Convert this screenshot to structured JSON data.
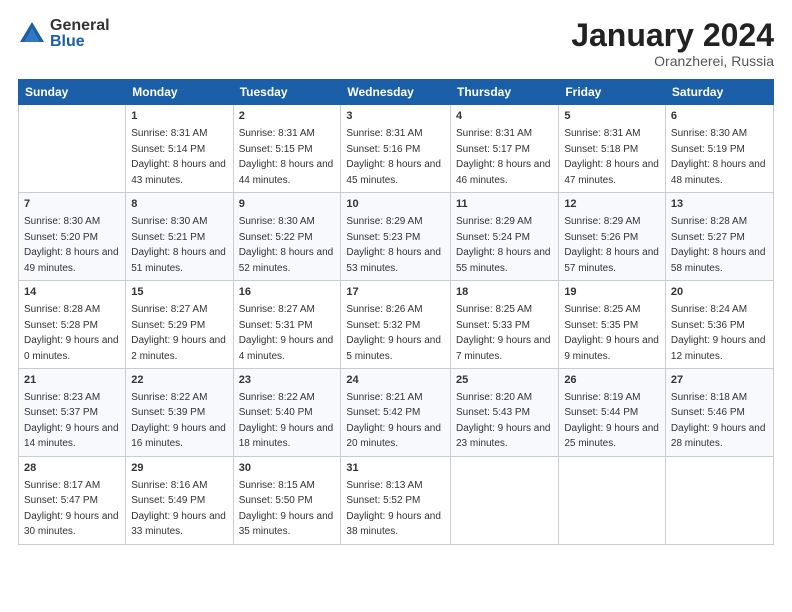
{
  "logo": {
    "general": "General",
    "blue": "Blue"
  },
  "header": {
    "month": "January 2024",
    "location": "Oranzherei, Russia"
  },
  "weekdays": [
    "Sunday",
    "Monday",
    "Tuesday",
    "Wednesday",
    "Thursday",
    "Friday",
    "Saturday"
  ],
  "weeks": [
    [
      {
        "day": "",
        "sunrise": "",
        "sunset": "",
        "daylight": ""
      },
      {
        "day": "1",
        "sunrise": "Sunrise: 8:31 AM",
        "sunset": "Sunset: 5:14 PM",
        "daylight": "Daylight: 8 hours and 43 minutes."
      },
      {
        "day": "2",
        "sunrise": "Sunrise: 8:31 AM",
        "sunset": "Sunset: 5:15 PM",
        "daylight": "Daylight: 8 hours and 44 minutes."
      },
      {
        "day": "3",
        "sunrise": "Sunrise: 8:31 AM",
        "sunset": "Sunset: 5:16 PM",
        "daylight": "Daylight: 8 hours and 45 minutes."
      },
      {
        "day": "4",
        "sunrise": "Sunrise: 8:31 AM",
        "sunset": "Sunset: 5:17 PM",
        "daylight": "Daylight: 8 hours and 46 minutes."
      },
      {
        "day": "5",
        "sunrise": "Sunrise: 8:31 AM",
        "sunset": "Sunset: 5:18 PM",
        "daylight": "Daylight: 8 hours and 47 minutes."
      },
      {
        "day": "6",
        "sunrise": "Sunrise: 8:30 AM",
        "sunset": "Sunset: 5:19 PM",
        "daylight": "Daylight: 8 hours and 48 minutes."
      }
    ],
    [
      {
        "day": "7",
        "sunrise": "Sunrise: 8:30 AM",
        "sunset": "Sunset: 5:20 PM",
        "daylight": "Daylight: 8 hours and 49 minutes."
      },
      {
        "day": "8",
        "sunrise": "Sunrise: 8:30 AM",
        "sunset": "Sunset: 5:21 PM",
        "daylight": "Daylight: 8 hours and 51 minutes."
      },
      {
        "day": "9",
        "sunrise": "Sunrise: 8:30 AM",
        "sunset": "Sunset: 5:22 PM",
        "daylight": "Daylight: 8 hours and 52 minutes."
      },
      {
        "day": "10",
        "sunrise": "Sunrise: 8:29 AM",
        "sunset": "Sunset: 5:23 PM",
        "daylight": "Daylight: 8 hours and 53 minutes."
      },
      {
        "day": "11",
        "sunrise": "Sunrise: 8:29 AM",
        "sunset": "Sunset: 5:24 PM",
        "daylight": "Daylight: 8 hours and 55 minutes."
      },
      {
        "day": "12",
        "sunrise": "Sunrise: 8:29 AM",
        "sunset": "Sunset: 5:26 PM",
        "daylight": "Daylight: 8 hours and 57 minutes."
      },
      {
        "day": "13",
        "sunrise": "Sunrise: 8:28 AM",
        "sunset": "Sunset: 5:27 PM",
        "daylight": "Daylight: 8 hours and 58 minutes."
      }
    ],
    [
      {
        "day": "14",
        "sunrise": "Sunrise: 8:28 AM",
        "sunset": "Sunset: 5:28 PM",
        "daylight": "Daylight: 9 hours and 0 minutes."
      },
      {
        "day": "15",
        "sunrise": "Sunrise: 8:27 AM",
        "sunset": "Sunset: 5:29 PM",
        "daylight": "Daylight: 9 hours and 2 minutes."
      },
      {
        "day": "16",
        "sunrise": "Sunrise: 8:27 AM",
        "sunset": "Sunset: 5:31 PM",
        "daylight": "Daylight: 9 hours and 4 minutes."
      },
      {
        "day": "17",
        "sunrise": "Sunrise: 8:26 AM",
        "sunset": "Sunset: 5:32 PM",
        "daylight": "Daylight: 9 hours and 5 minutes."
      },
      {
        "day": "18",
        "sunrise": "Sunrise: 8:25 AM",
        "sunset": "Sunset: 5:33 PM",
        "daylight": "Daylight: 9 hours and 7 minutes."
      },
      {
        "day": "19",
        "sunrise": "Sunrise: 8:25 AM",
        "sunset": "Sunset: 5:35 PM",
        "daylight": "Daylight: 9 hours and 9 minutes."
      },
      {
        "day": "20",
        "sunrise": "Sunrise: 8:24 AM",
        "sunset": "Sunset: 5:36 PM",
        "daylight": "Daylight: 9 hours and 12 minutes."
      }
    ],
    [
      {
        "day": "21",
        "sunrise": "Sunrise: 8:23 AM",
        "sunset": "Sunset: 5:37 PM",
        "daylight": "Daylight: 9 hours and 14 minutes."
      },
      {
        "day": "22",
        "sunrise": "Sunrise: 8:22 AM",
        "sunset": "Sunset: 5:39 PM",
        "daylight": "Daylight: 9 hours and 16 minutes."
      },
      {
        "day": "23",
        "sunrise": "Sunrise: 8:22 AM",
        "sunset": "Sunset: 5:40 PM",
        "daylight": "Daylight: 9 hours and 18 minutes."
      },
      {
        "day": "24",
        "sunrise": "Sunrise: 8:21 AM",
        "sunset": "Sunset: 5:42 PM",
        "daylight": "Daylight: 9 hours and 20 minutes."
      },
      {
        "day": "25",
        "sunrise": "Sunrise: 8:20 AM",
        "sunset": "Sunset: 5:43 PM",
        "daylight": "Daylight: 9 hours and 23 minutes."
      },
      {
        "day": "26",
        "sunrise": "Sunrise: 8:19 AM",
        "sunset": "Sunset: 5:44 PM",
        "daylight": "Daylight: 9 hours and 25 minutes."
      },
      {
        "day": "27",
        "sunrise": "Sunrise: 8:18 AM",
        "sunset": "Sunset: 5:46 PM",
        "daylight": "Daylight: 9 hours and 28 minutes."
      }
    ],
    [
      {
        "day": "28",
        "sunrise": "Sunrise: 8:17 AM",
        "sunset": "Sunset: 5:47 PM",
        "daylight": "Daylight: 9 hours and 30 minutes."
      },
      {
        "day": "29",
        "sunrise": "Sunrise: 8:16 AM",
        "sunset": "Sunset: 5:49 PM",
        "daylight": "Daylight: 9 hours and 33 minutes."
      },
      {
        "day": "30",
        "sunrise": "Sunrise: 8:15 AM",
        "sunset": "Sunset: 5:50 PM",
        "daylight": "Daylight: 9 hours and 35 minutes."
      },
      {
        "day": "31",
        "sunrise": "Sunrise: 8:13 AM",
        "sunset": "Sunset: 5:52 PM",
        "daylight": "Daylight: 9 hours and 38 minutes."
      },
      {
        "day": "",
        "sunrise": "",
        "sunset": "",
        "daylight": ""
      },
      {
        "day": "",
        "sunrise": "",
        "sunset": "",
        "daylight": ""
      },
      {
        "day": "",
        "sunrise": "",
        "sunset": "",
        "daylight": ""
      }
    ]
  ]
}
